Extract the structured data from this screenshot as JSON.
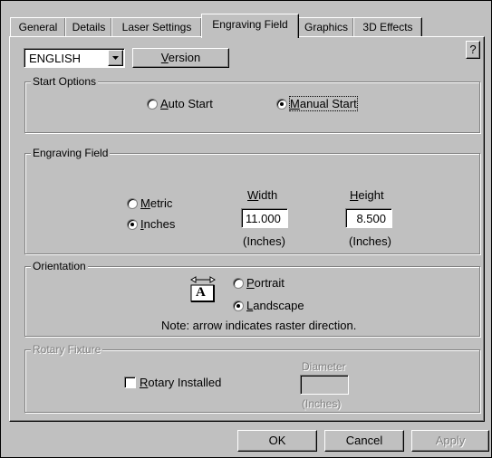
{
  "tabs": [
    {
      "label": "General"
    },
    {
      "label": "Details"
    },
    {
      "label": "Laser Settings"
    },
    {
      "label": "Engraving Field"
    },
    {
      "label": "Graphics"
    },
    {
      "label": "3D Effects"
    }
  ],
  "active_tab": "Engraving Field",
  "help_button": "?",
  "language": {
    "selected": "ENGLISH"
  },
  "version_button": {
    "accel": "V",
    "rest": "ersion"
  },
  "start_options": {
    "title": "Start Options",
    "auto": {
      "accel": "A",
      "rest": "uto Start",
      "checked": false
    },
    "manual": {
      "accel": "M",
      "rest": "anual Start",
      "checked": true
    }
  },
  "engraving_field": {
    "title": "Engraving Field",
    "metric": {
      "accel": "M",
      "rest": "etric",
      "checked": false
    },
    "inches": {
      "accel": "I",
      "rest": "nches",
      "checked": true
    },
    "width": {
      "accel": "W",
      "rest": "idth",
      "value": "11.000",
      "unit": "(Inches)"
    },
    "height": {
      "accel": "H",
      "rest": "eight",
      "value": "8.500",
      "unit": "(Inches)"
    }
  },
  "orientation": {
    "title": "Orientation",
    "icon_letter": "A",
    "portrait": {
      "accel": "P",
      "rest": "ortrait",
      "checked": false
    },
    "landscape": {
      "accel": "L",
      "rest": "andscape",
      "checked": true
    },
    "note": "Note: arrow indicates raster direction."
  },
  "rotary": {
    "title": "Rotary Fixture",
    "installed": {
      "accel": "R",
      "rest": "otary Installed",
      "checked": false
    },
    "diameter_label": "Diameter",
    "diameter_value": "",
    "diameter_unit": "(Inches)"
  },
  "buttons": {
    "ok": "OK",
    "cancel": "Cancel",
    "apply": "Apply"
  }
}
